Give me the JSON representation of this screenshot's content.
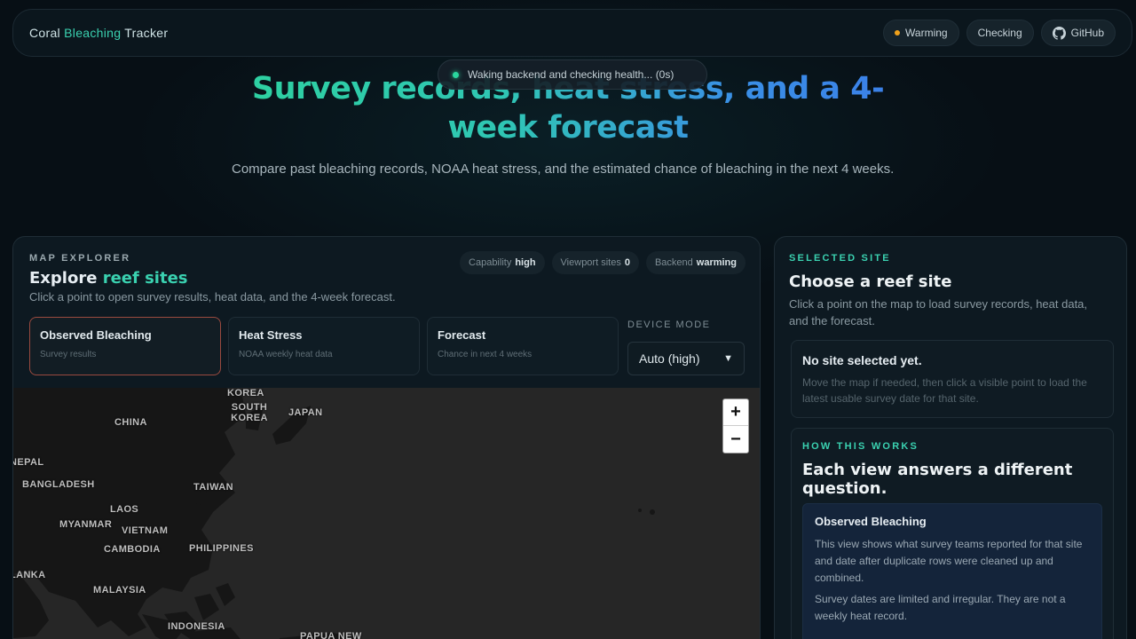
{
  "nav": {
    "brand_1": "Coral ",
    "brand_2": "Bleaching",
    "brand_3": " Tracker",
    "warming": "Warming",
    "checking": "Checking",
    "github": "GitHub"
  },
  "toast": "Waking backend and checking health... (0s)",
  "hero": {
    "title_line1": "Survey records, heat stress, and a 4-",
    "title_line2": "week forecast",
    "subtitle": "Compare past bleaching records, NOAA heat stress, and the estimated chance of bleaching in the next 4 weeks."
  },
  "map_panel": {
    "kicker": "MAP EXPLORER",
    "title_1": "Explore ",
    "title_2": "reef sites",
    "desc": "Click a point to open survey results, heat data, and the 4-week forecast.",
    "chips": [
      {
        "label": "Capability",
        "value": "high"
      },
      {
        "label": "Viewport sites",
        "value": "0"
      },
      {
        "label": "Backend",
        "value": "warming"
      }
    ],
    "tabs": [
      {
        "title": "Observed Bleaching",
        "sub": "Survey results"
      },
      {
        "title": "Heat Stress",
        "sub": "NOAA weekly heat data"
      },
      {
        "title": "Forecast",
        "sub": "Chance in next 4 weeks"
      }
    ],
    "device_label": "DEVICE MODE",
    "device_value": "Auto (high)",
    "zoom_in": "+",
    "zoom_out": "−",
    "labels": [
      "KOREA",
      "SOUTH KOREA",
      "JAPAN",
      "CHINA",
      "NEPAL",
      "BANGLADESH",
      "TAIWAN",
      "LAOS",
      "MYANMAR",
      "VIETNAM",
      "CAMBODIA",
      "PHILIPPINES",
      "LANKA",
      "MALAYSIA",
      "INDONESIA",
      "PAPUA NEW"
    ]
  },
  "side_panel": {
    "kicker": "SELECTED SITE",
    "title": "Choose a reef site",
    "desc": "Click a point on the map to load survey records, heat data, and the forecast.",
    "empty_title": "No site selected yet.",
    "empty_desc": "Move the map if needed, then click a visible point to load the latest usable survey date for that site.",
    "how_kicker": "HOW THIS WORKS",
    "how_title": "Each view answers a different question.",
    "inner_title": "Observed Bleaching",
    "inner_p1": "This view shows what survey teams reported for that site and date after duplicate rows were cleaned up and combined.",
    "inner_p2": "Survey dates are limited and irregular. They are not a weekly heat record."
  }
}
